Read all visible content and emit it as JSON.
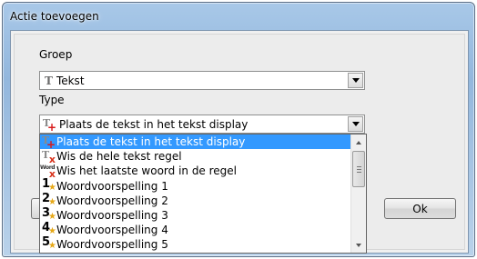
{
  "window": {
    "title": "Actie toevoegen"
  },
  "groep": {
    "label": "Groep",
    "value": "Tekst",
    "icon": "text-t-icon"
  },
  "type": {
    "label": "Type",
    "value": "Plaats de tekst in het tekst display",
    "icon": "text-add-icon"
  },
  "dropdown": {
    "items": [
      {
        "label": "Plaats de tekst in het tekst display",
        "icon": "text-add-icon",
        "selected": true
      },
      {
        "label": "Wis de hele tekst regel",
        "icon": "text-clear-icon"
      },
      {
        "label": "Wis het laatste woord in de regel",
        "icon": "word-clear-icon",
        "icon_text": "Word"
      },
      {
        "label": "Woordvoorspelling 1",
        "icon": "prediction-star-icon",
        "num": "1"
      },
      {
        "label": "Woordvoorspelling 2",
        "icon": "prediction-star-icon",
        "num": "2"
      },
      {
        "label": "Woordvoorspelling 3",
        "icon": "prediction-star-icon",
        "num": "3"
      },
      {
        "label": "Woordvoorspelling 4",
        "icon": "prediction-star-icon",
        "num": "4"
      },
      {
        "label": "Woordvoorspelling 5",
        "icon": "prediction-star-icon",
        "num": "5"
      }
    ]
  },
  "buttons": {
    "ok": "Ok"
  },
  "colors": {
    "selection": "#3399ff",
    "star": "#e6a817",
    "accent_red": "#d81b1b"
  }
}
